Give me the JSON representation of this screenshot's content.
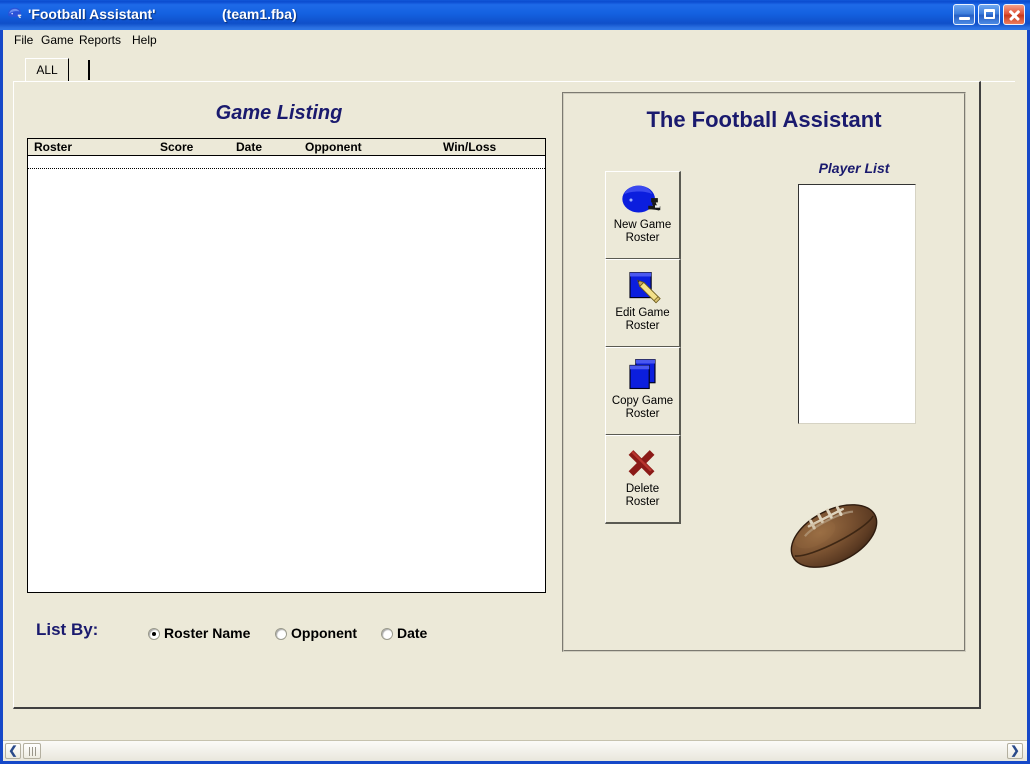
{
  "window": {
    "title": "'Football Assistant'",
    "file": "(team1.fba)",
    "icon": "helmet-icon",
    "minimize_label": "_",
    "maximize_label": "□",
    "close_label": "✕"
  },
  "menu": {
    "items": [
      {
        "label": "File"
      },
      {
        "label": "Game"
      },
      {
        "label": "Reports"
      },
      {
        "label": "Help"
      }
    ]
  },
  "tabs": [
    {
      "label": "ALL",
      "selected": true
    }
  ],
  "game_listing": {
    "title": "Game Listing",
    "columns": [
      "Roster",
      "Score",
      "Date",
      "Opponent",
      "Win/Loss"
    ],
    "rows": []
  },
  "list_by": {
    "label": "List By:",
    "options": [
      {
        "label": "Roster Name",
        "selected": true
      },
      {
        "label": "Opponent",
        "selected": false
      },
      {
        "label": "Date",
        "selected": false
      }
    ]
  },
  "right_panel": {
    "title": "The Football Assistant",
    "buttons": [
      {
        "line1": "New Game",
        "line2": "Roster",
        "icon": "helmet-icon"
      },
      {
        "line1": "Edit Game",
        "line2": "Roster",
        "icon": "notepad-pencil-icon"
      },
      {
        "line1": "Copy Game",
        "line2": "Roster",
        "icon": "copy-pages-icon"
      },
      {
        "line1": "Delete",
        "line2": "Roster",
        "icon": "red-x-icon"
      }
    ],
    "player_list": {
      "title": "Player List",
      "items": []
    },
    "decoration": "football-image"
  },
  "scrollbar": {
    "left_arrow": "❮",
    "right_arrow": "❯"
  },
  "colors": {
    "navy_heading": "#1a1a6e",
    "window_chrome": "#ece9d8",
    "title_blue": "#1461e0",
    "icon_blue": "#0b1ede",
    "delete_red": "#8b1a17",
    "football_brown": "#6b4a2e"
  }
}
